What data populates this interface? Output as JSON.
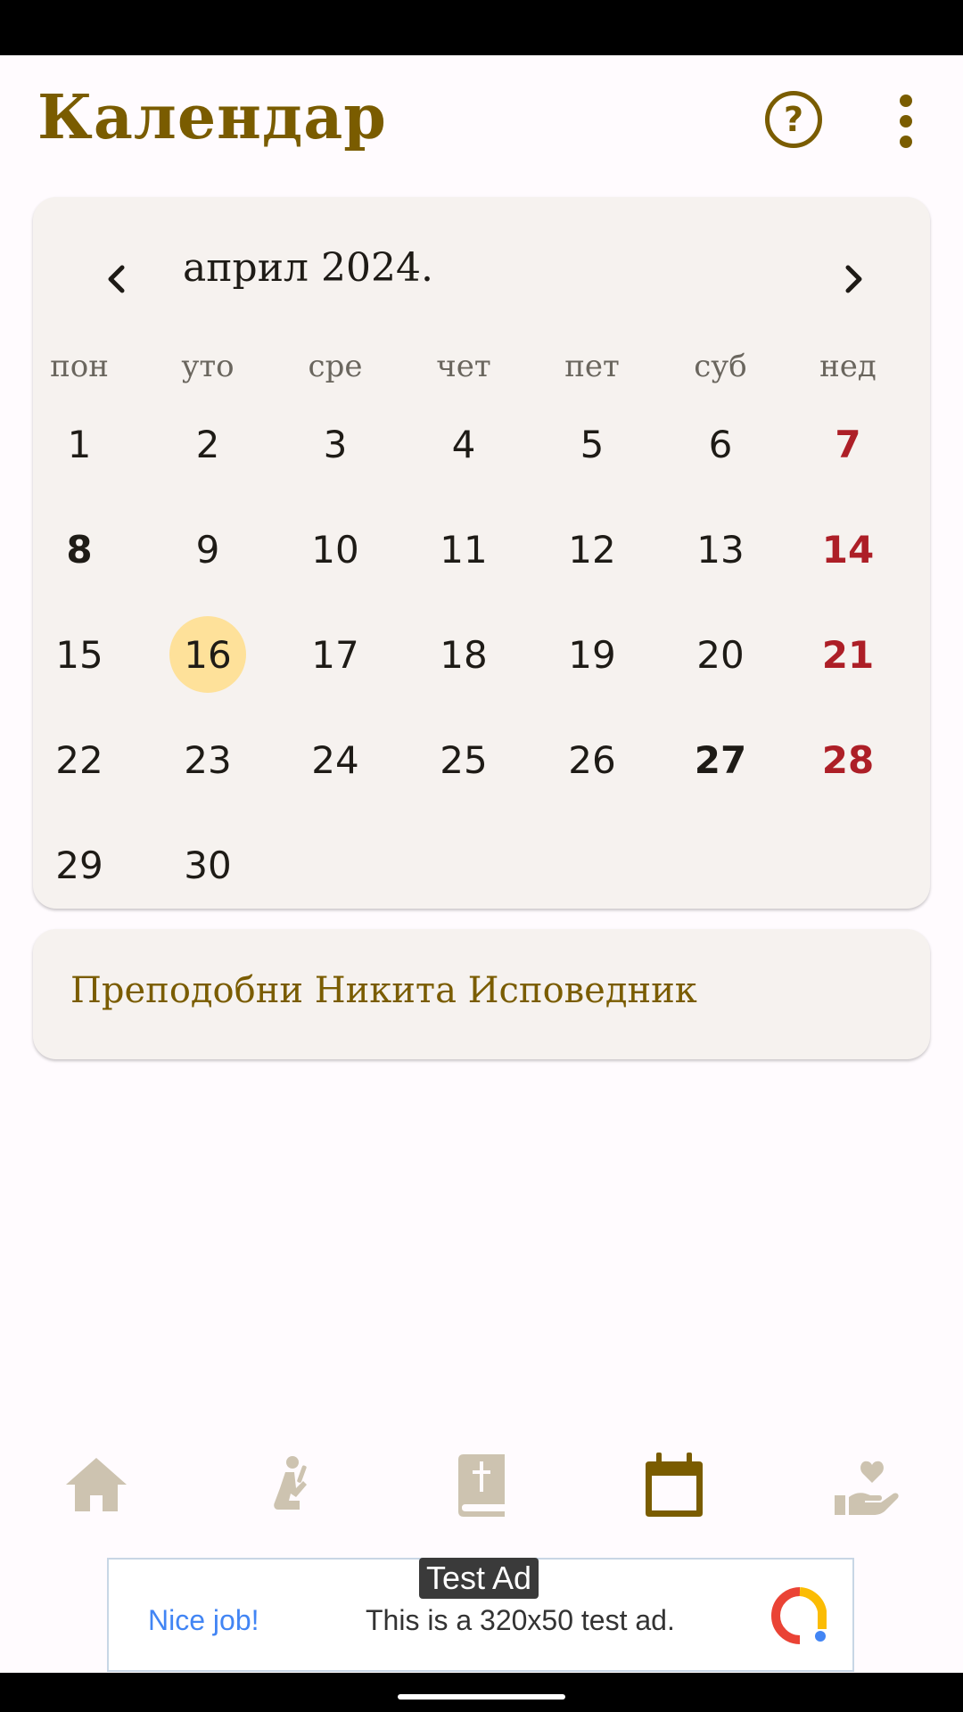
{
  "app": {
    "title": "Календар"
  },
  "calendar": {
    "month_label": "април 2024.",
    "weekdays": [
      "пон",
      "уто",
      "сре",
      "чет",
      "пет",
      "суб",
      "нед"
    ],
    "weeks": [
      [
        "1",
        "2",
        "3",
        "4",
        "5",
        "6",
        "7"
      ],
      [
        "8",
        "9",
        "10",
        "11",
        "12",
        "13",
        "14"
      ],
      [
        "15",
        "16",
        "17",
        "18",
        "19",
        "20",
        "21"
      ],
      [
        "22",
        "23",
        "24",
        "25",
        "26",
        "27",
        "28"
      ],
      [
        "29",
        "30",
        "",
        "",
        "",
        "",
        ""
      ]
    ],
    "selected_day": "16",
    "bold_days": [
      "8",
      "27"
    ],
    "sunday_color": "#ad1f27",
    "selected_color": "#fee19a"
  },
  "saint": {
    "text": "Преподобни Никита Исповедник"
  },
  "bottom_nav": {
    "items": [
      "home-icon",
      "prayer-icon",
      "bible-icon",
      "calendar-icon",
      "charity-icon"
    ],
    "active": "calendar-icon",
    "active_color": "#7a5c00",
    "inactive_color": "#cdc3b0"
  },
  "ad": {
    "badge": "Test Ad",
    "nice": "Nice job!",
    "text": "This is a 320x50 test ad."
  }
}
